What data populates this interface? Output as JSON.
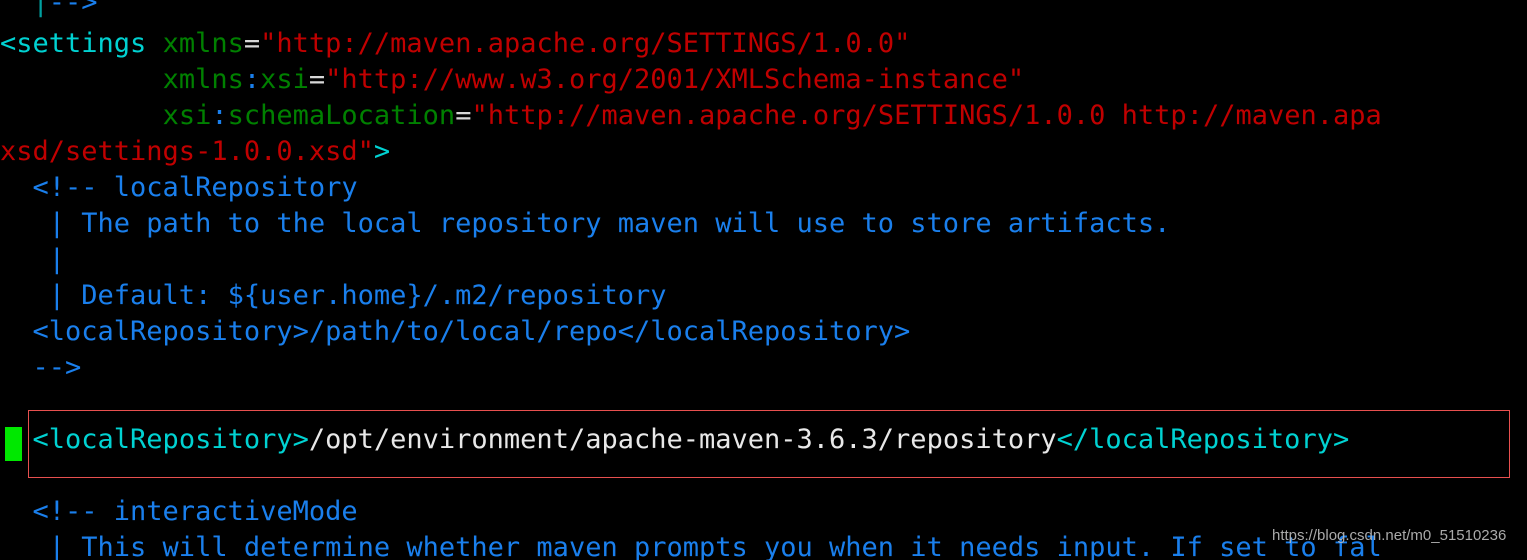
{
  "editor": {
    "language": "xml",
    "filename_hint": "settings.xml",
    "background_color": "#000000",
    "font_size_px": 27,
    "line_height_px": 36,
    "colors": {
      "tag": "#00d2d2",
      "attribute_name": "#008000",
      "attribute_value": "#c00000",
      "comment": "#1a7fec",
      "text": "#e8e8e8",
      "equals": "#d8d8d8",
      "caret_block": "#00e800",
      "highlight_border": "#e8504f"
    }
  },
  "caret": {
    "shape": "block",
    "color": "#00e800"
  },
  "highlight": {
    "border_color": "#e8504f",
    "target_line_index": 11
  },
  "watermark": {
    "text": "https://blog.csdn.net/m0_51510236"
  },
  "lines": [
    {
      "index": 0,
      "clipped_top": true,
      "segments": [
        {
          "cls": "cmt",
          "text": "  "
        },
        {
          "cls": "cmtbar",
          "text": "|"
        },
        {
          "cls": "cmt",
          "text": "-->"
        }
      ]
    },
    {
      "index": 1,
      "segments": [
        {
          "cls": "tag",
          "text": "<settings"
        },
        {
          "cls": "txt",
          "text": " "
        },
        {
          "cls": "attr",
          "text": "xmlns"
        },
        {
          "cls": "eq",
          "text": "="
        },
        {
          "cls": "val",
          "text": "\"http://maven.apache.org/SETTINGS/1.0.0\""
        }
      ]
    },
    {
      "index": 2,
      "segments": [
        {
          "cls": "txt",
          "text": "          "
        },
        {
          "cls": "attr",
          "text": "xmlns"
        },
        {
          "cls": "punct",
          "text": ":"
        },
        {
          "cls": "attr",
          "text": "xsi"
        },
        {
          "cls": "eq",
          "text": "="
        },
        {
          "cls": "val",
          "text": "\"http://www.w3.org/2001/XMLSchema-instance\""
        }
      ]
    },
    {
      "index": 3,
      "segments": [
        {
          "cls": "txt",
          "text": "          "
        },
        {
          "cls": "attr",
          "text": "xsi"
        },
        {
          "cls": "punct",
          "text": ":"
        },
        {
          "cls": "attr",
          "text": "schemaLocation"
        },
        {
          "cls": "eq",
          "text": "="
        },
        {
          "cls": "val",
          "text": "\"http://maven.apache.org/SETTINGS/1.0.0 http://maven.apa"
        }
      ]
    },
    {
      "index": 4,
      "segments": [
        {
          "cls": "val",
          "text": "xsd/settings-1.0.0.xsd\""
        },
        {
          "cls": "tag",
          "text": ">"
        }
      ]
    },
    {
      "index": 5,
      "segments": [
        {
          "cls": "cmt",
          "text": "  <!-- localRepository"
        }
      ]
    },
    {
      "index": 6,
      "segments": [
        {
          "cls": "cmt",
          "text": "   | The path to the local repository maven will use to store artifacts."
        }
      ]
    },
    {
      "index": 7,
      "segments": [
        {
          "cls": "cmt",
          "text": "   |"
        }
      ]
    },
    {
      "index": 8,
      "segments": [
        {
          "cls": "cmt",
          "text": "   | Default: ${user.home}/.m2/repository"
        }
      ]
    },
    {
      "index": 9,
      "segments": [
        {
          "cls": "cmt",
          "text": "  <localRepository>/path/to/local/repo</localRepository>"
        }
      ]
    },
    {
      "index": 10,
      "segments": [
        {
          "cls": "cmt",
          "text": "  -->"
        }
      ]
    },
    {
      "index": 11,
      "segments": [
        {
          "cls": "txt",
          "text": "  "
        }
      ]
    },
    {
      "index": 12,
      "highlighted": true,
      "segments": [
        {
          "cls": "txt",
          "text": "  "
        },
        {
          "cls": "tag",
          "text": "<localRepository>"
        },
        {
          "cls": "txt",
          "text": "/opt/environment/apache-maven-3.6.3/repository"
        },
        {
          "cls": "tag",
          "text": "</localRepository>"
        }
      ]
    },
    {
      "index": 13,
      "segments": [
        {
          "cls": "txt",
          "text": "  "
        }
      ]
    },
    {
      "index": 14,
      "segments": [
        {
          "cls": "cmt",
          "text": "  <!-- interactiveMode"
        }
      ]
    },
    {
      "index": 15,
      "clipped_bottom": true,
      "segments": [
        {
          "cls": "cmt",
          "text": "   | This will determine whether maven prompts you when it needs input. If set to fal"
        }
      ]
    }
  ]
}
